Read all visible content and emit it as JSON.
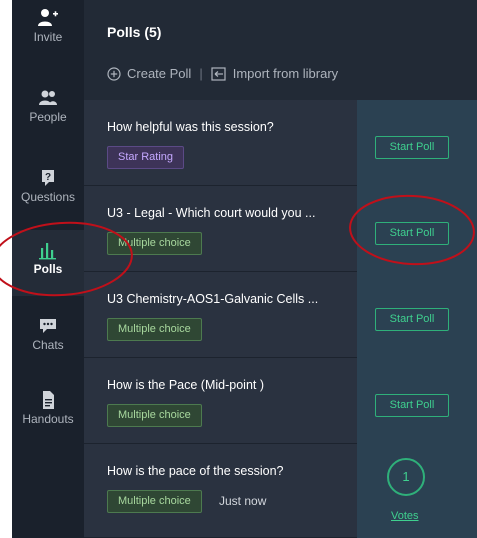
{
  "sidebar": {
    "items": [
      {
        "label": "Invite",
        "icon": "add-person-icon"
      },
      {
        "label": "People",
        "icon": "people-icon"
      },
      {
        "label": "Questions",
        "icon": "question-icon"
      },
      {
        "label": "Polls",
        "icon": "bar-chart-icon"
      },
      {
        "label": "Chats",
        "icon": "chat-icon"
      },
      {
        "label": "Handouts",
        "icon": "document-icon"
      }
    ]
  },
  "header": {
    "title": "Polls (5)",
    "create_poll": "Create Poll",
    "separator": "|",
    "import": "Import from library"
  },
  "polls": [
    {
      "title": "How helpful was this session?",
      "type": "Star Rating",
      "action": "Start Poll"
    },
    {
      "title": "U3 - Legal - Which court would you ...",
      "type": "Multiple choice",
      "action": "Start Poll"
    },
    {
      "title": "U3 Chemistry-AOS1-Galvanic Cells ...",
      "type": "Multiple choice",
      "action": "Start Poll"
    },
    {
      "title": "How is the Pace (Mid-point )",
      "type": "Multiple choice",
      "action": "Start Poll"
    },
    {
      "title": "How is the pace of the session?",
      "type": "Multiple choice",
      "time": "Just now",
      "votes_count": "1",
      "votes_label": "Votes"
    }
  ],
  "colors": {
    "sidebar_bg": "#1a212c",
    "main_bg": "#222a36",
    "row_bg": "#2a3240",
    "action_col_bg": "#2b4152",
    "accent_green": "#3fd08f",
    "annotation_red": "#c0101a"
  }
}
